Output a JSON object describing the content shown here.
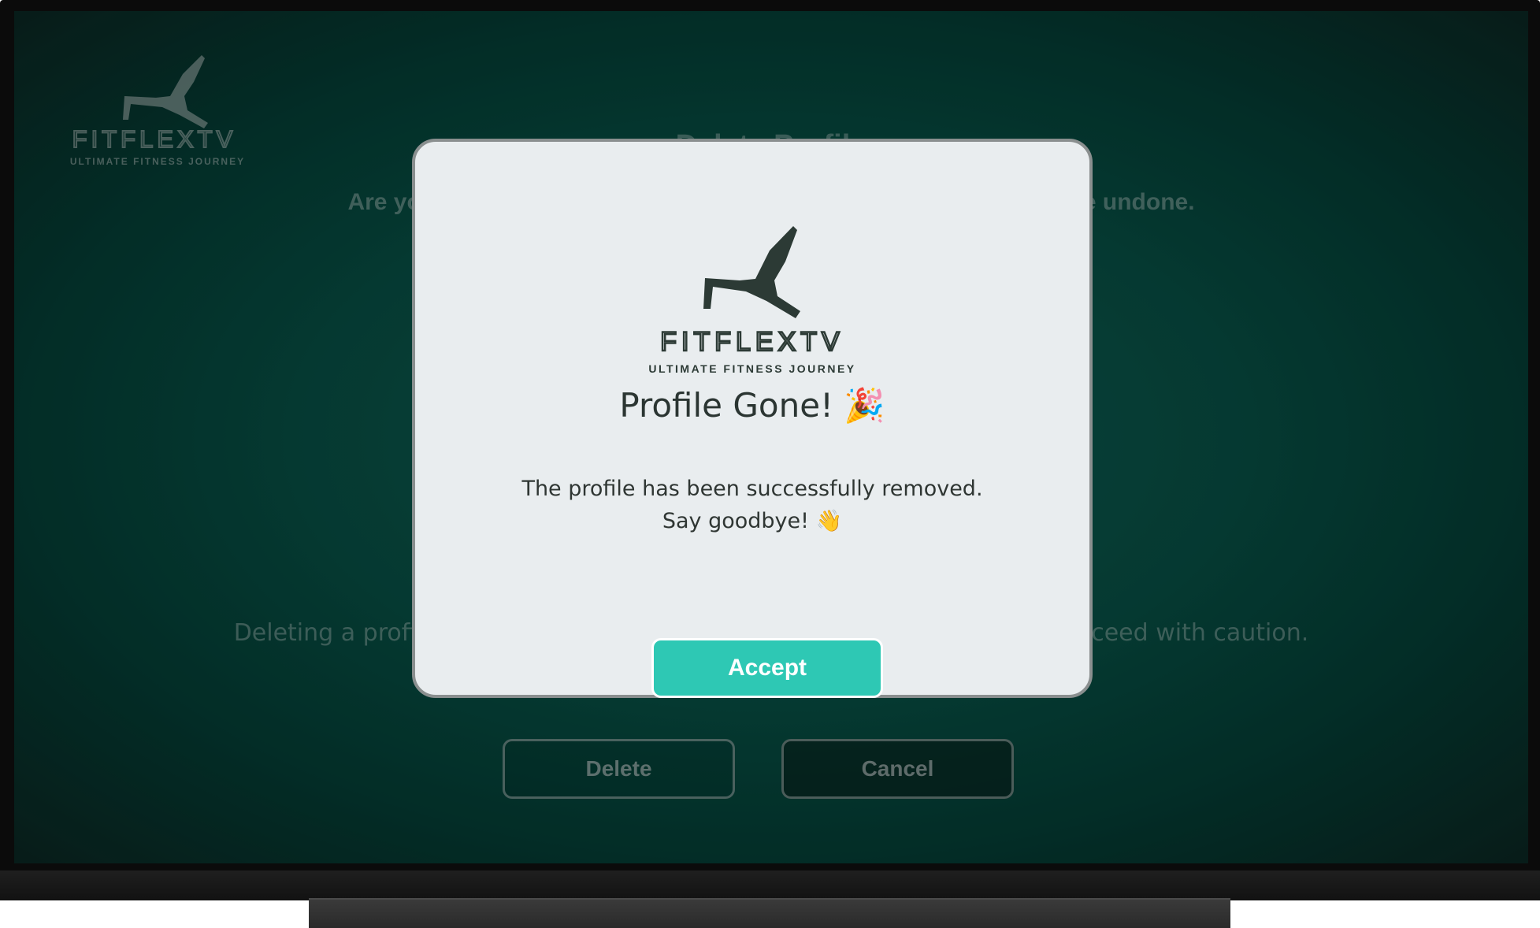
{
  "brand": {
    "name": "FITFLEXTV",
    "tagline": "ULTIMATE FITNESS JOURNEY",
    "logo_icon": "yoga-pose-icon"
  },
  "background_page": {
    "title": "Delete Profile",
    "question": "Are you sure you want to delete this profile? This action cannot be undone.",
    "warning": "Deleting a profile will permanently remove all of its data and history. Proceed with caution.",
    "delete_label": "Delete",
    "cancel_label": "Cancel"
  },
  "modal": {
    "title": "Profile Gone! 🎉",
    "message": "The profile has been successfully removed. Say goodbye! 👋",
    "accept_label": "Accept"
  },
  "colors": {
    "screen_bg": "#07493f",
    "modal_bg": "#e9edef",
    "accent": "#2ec8b4",
    "text_dark": "#2b3532"
  }
}
